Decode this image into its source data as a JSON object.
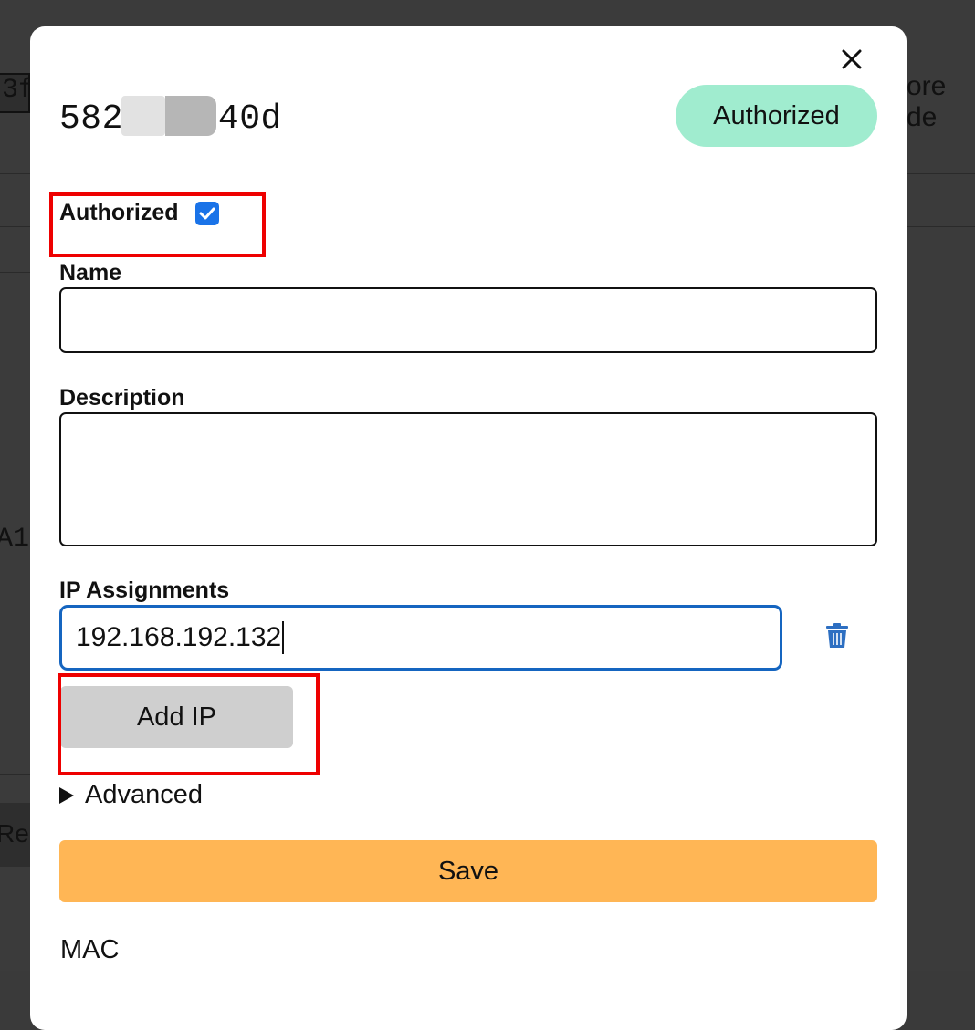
{
  "background": {
    "fragment_left_top": "3f",
    "fragment_right_top": "ore de",
    "fragment_left_mid": "A1",
    "fragment_left_bottom": "Re"
  },
  "modal": {
    "close_icon": "close-icon",
    "device_id_prefix": "582",
    "device_id_suffix": "40d",
    "status_badge": "Authorized",
    "status_color": "#a0eccf",
    "authorized_label": "Authorized",
    "authorized_checked": true,
    "name_label": "Name",
    "name_value": "",
    "description_label": "Description",
    "description_value": "",
    "ip_assignments_label": "IP Assignments",
    "ip_assignments": [
      "192.168.192.132"
    ],
    "trash_icon": "trash-icon",
    "add_ip_label": "Add IP",
    "advanced_label": "Advanced",
    "save_label": "Save",
    "save_color": "#ffb655",
    "mac_label": "MAC"
  }
}
